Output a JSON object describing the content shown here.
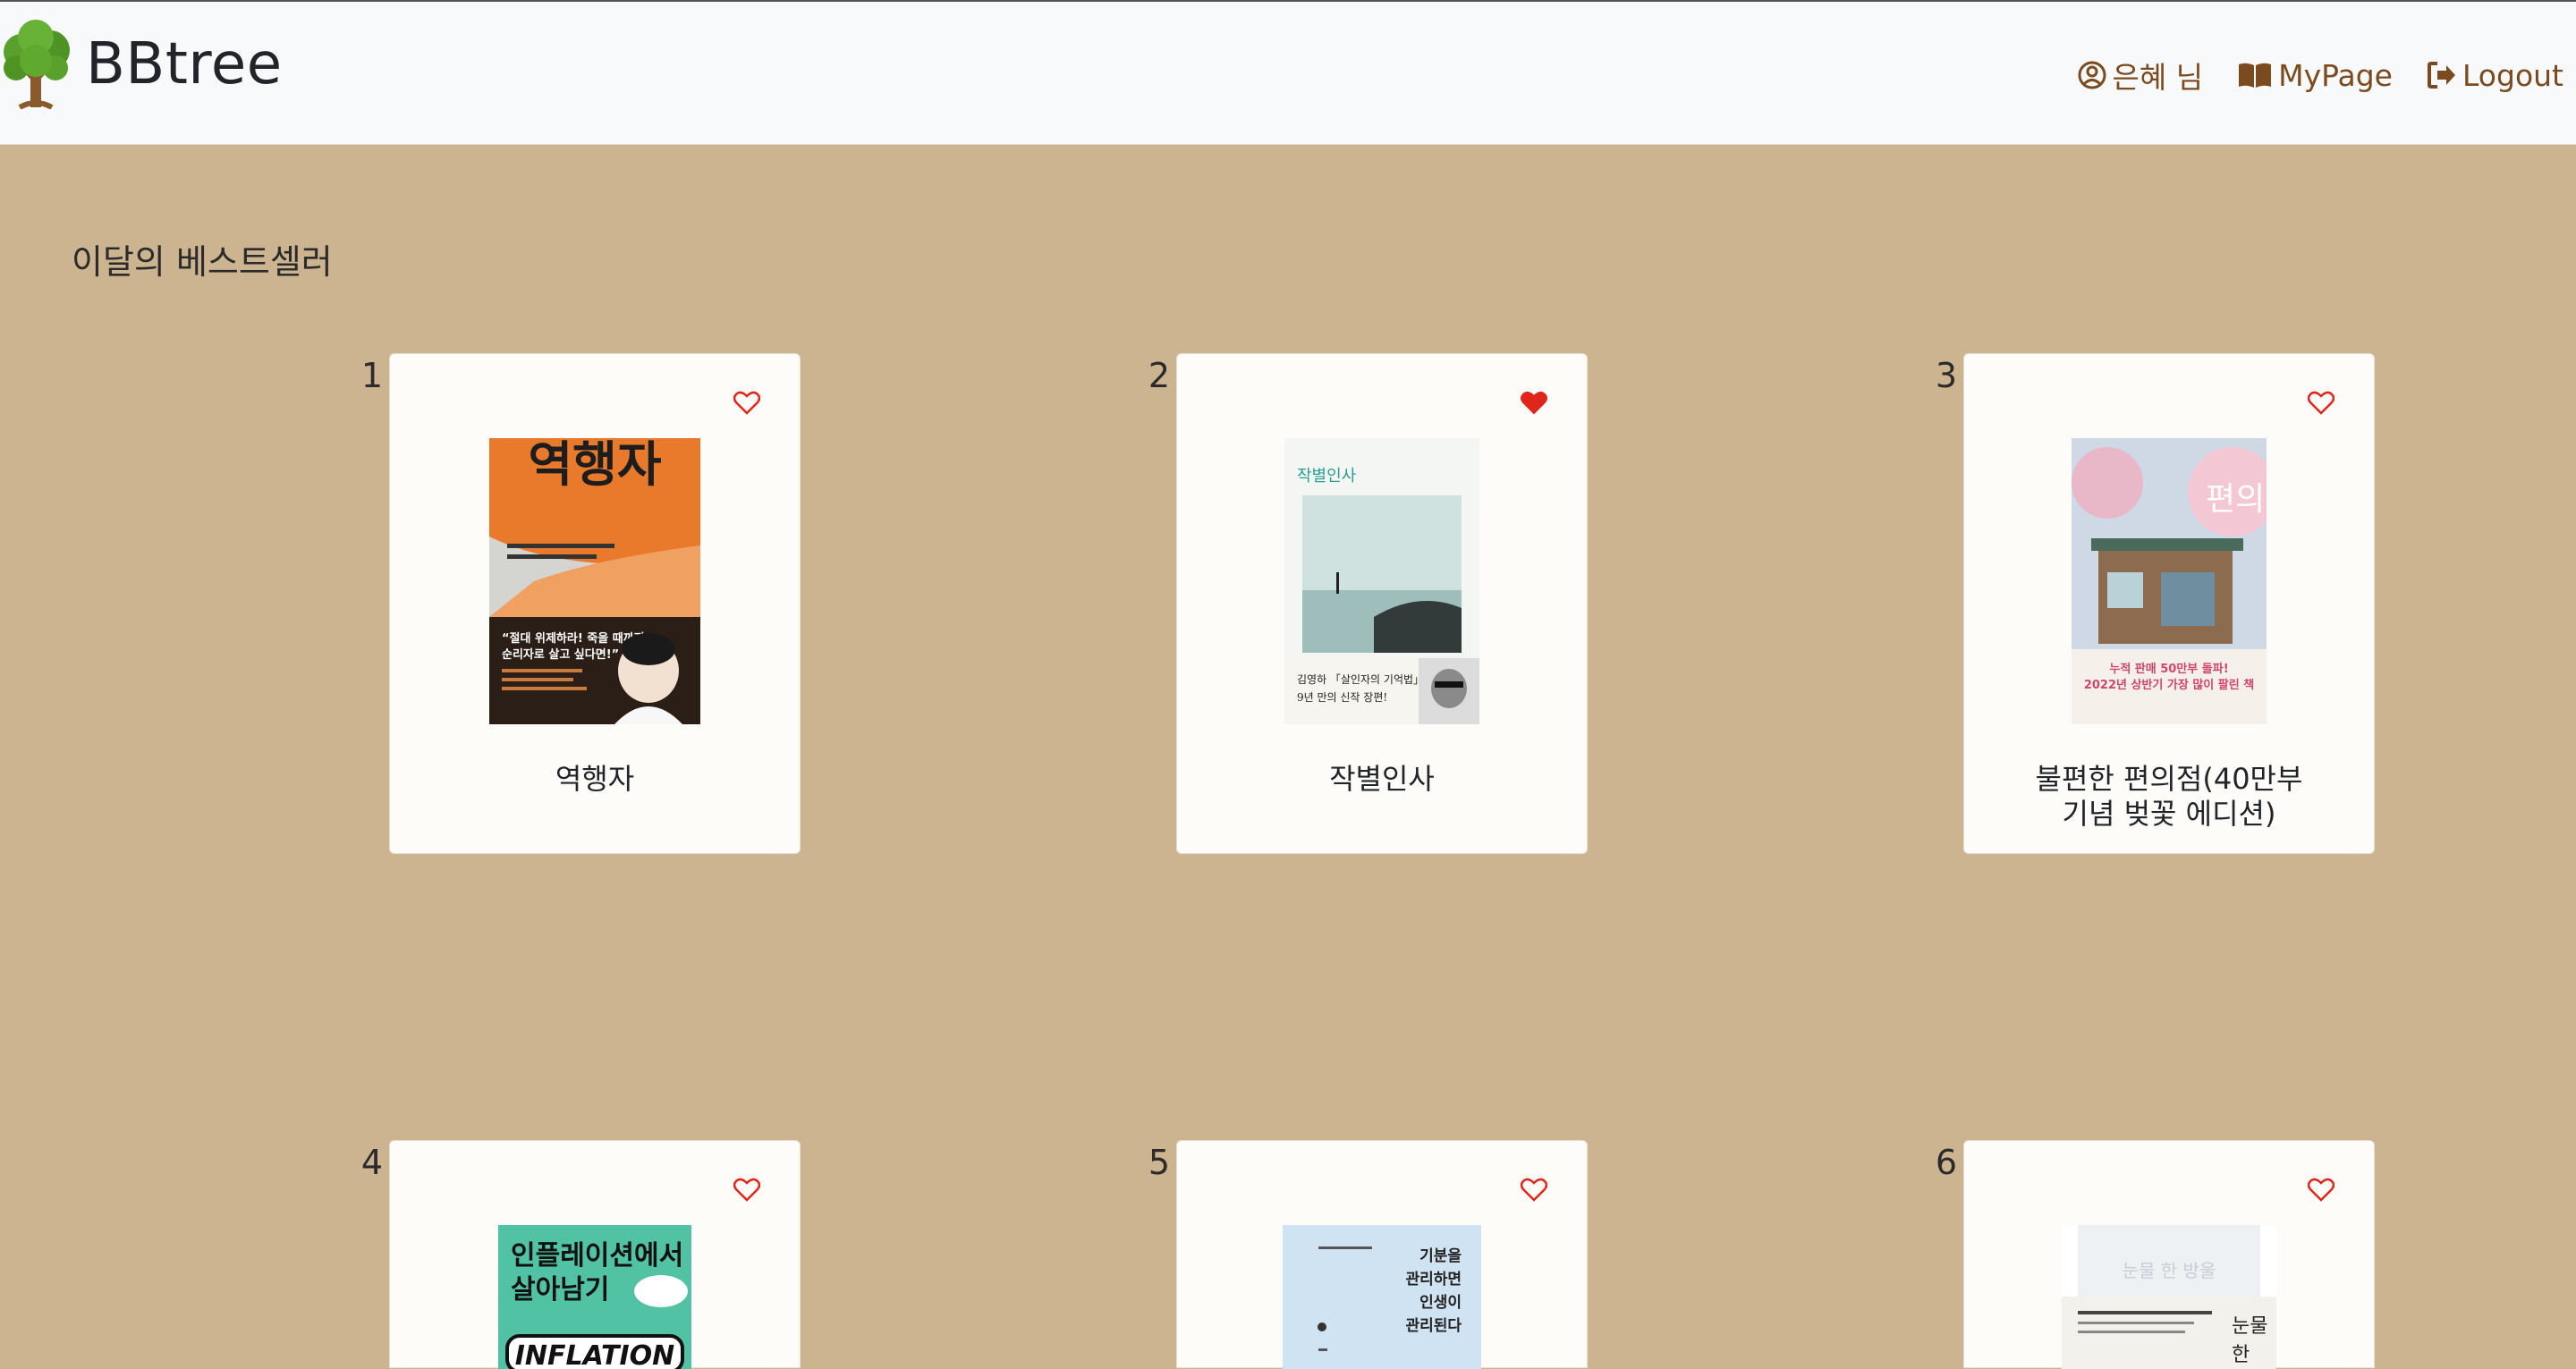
{
  "app": {
    "brand": "BBtree"
  },
  "nav": {
    "user_label": "은혜 님",
    "mypage_label": "MyPage",
    "logout_label": "Logout"
  },
  "section": {
    "title": "이달의 베스트셀러"
  },
  "colors": {
    "accent": "#7b4a1f",
    "background": "#cdb491",
    "heart": "#e0261b"
  },
  "books": [
    {
      "rank": "1",
      "title": "역행자",
      "liked": false,
      "cover_text": {
        "big": "역행자",
        "quote": "\"절대 위제하라! 죽을 때까지 순리자로 살고 싶다면!\""
      }
    },
    {
      "rank": "2",
      "title": "작별인사",
      "liked": true,
      "cover_text": {
        "big": "작별인사",
        "sub": "김영하 「살인자의 기억법」 이후 9년 만의 신작 장편!"
      }
    },
    {
      "rank": "3",
      "title": "불편한 편의점(40만부 기념 벚꽃 에디션)",
      "liked": false,
      "cover_text": {
        "big": "불편한 편의점",
        "sub": "누적 판매 50만부 돌파! 2022년 상반기 가장 많이 팔린 책"
      }
    },
    {
      "rank": "4",
      "title": "",
      "liked": false,
      "cover_text": {
        "big": "인플레이션에서 살아남기",
        "sub": "INFLATION"
      }
    },
    {
      "rank": "5",
      "title": "",
      "liked": false,
      "cover_text": {
        "big": "기분을 관리하면 인생이 관리된다"
      }
    },
    {
      "rank": "6",
      "title": "",
      "liked": false,
      "cover_text": {
        "big": "눈물 한 방울"
      }
    }
  ]
}
